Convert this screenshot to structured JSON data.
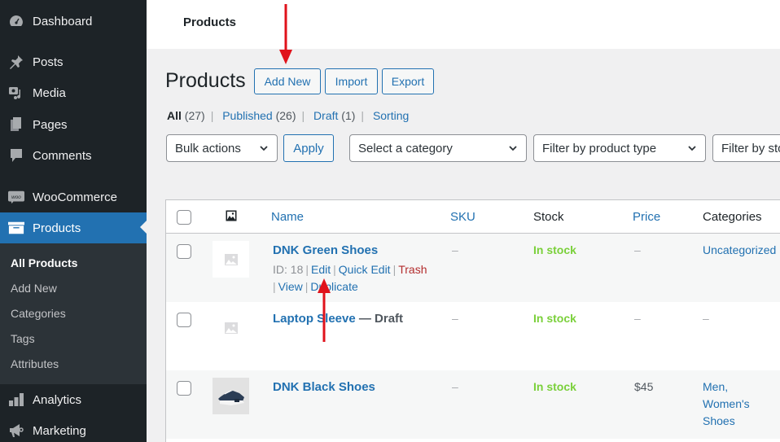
{
  "sidebar": {
    "items": [
      {
        "label": "Dashboard",
        "icon": "dashboard-icon"
      },
      {
        "label": "Posts",
        "icon": "pin-icon"
      },
      {
        "label": "Media",
        "icon": "media-icon"
      },
      {
        "label": "Pages",
        "icon": "pages-icon"
      },
      {
        "label": "Comments",
        "icon": "comment-icon"
      },
      {
        "label": "WooCommerce",
        "icon": "woo-icon"
      },
      {
        "label": "Products",
        "icon": "archive-box-icon",
        "active": true
      },
      {
        "label": "Analytics",
        "icon": "bar-chart-icon"
      },
      {
        "label": "Marketing",
        "icon": "megaphone-icon"
      }
    ],
    "submenu": [
      {
        "label": "All Products",
        "current": true
      },
      {
        "label": "Add New"
      },
      {
        "label": "Categories"
      },
      {
        "label": "Tags"
      },
      {
        "label": "Attributes"
      }
    ]
  },
  "topbar": {
    "title": "Products"
  },
  "heading": {
    "title": "Products",
    "buttons": {
      "add_new": "Add New",
      "import": "Import",
      "export": "Export"
    }
  },
  "views": [
    {
      "label": "All",
      "count": "(27)",
      "current": true
    },
    {
      "label": "Published",
      "count": "(26)"
    },
    {
      "label": "Draft",
      "count": "(1)"
    },
    {
      "label": "Sorting",
      "count": ""
    }
  ],
  "filters": {
    "bulk_actions": "Bulk actions",
    "apply": "Apply",
    "category": "Select a category",
    "product_type": "Filter by product type",
    "stock_status": "Filter by stock status"
  },
  "table": {
    "columns": {
      "image": "image-icon",
      "name": "Name",
      "sku": "SKU",
      "stock": "Stock",
      "price": "Price",
      "categories": "Categories"
    },
    "rows": [
      {
        "name": "DNK Green Shoes",
        "status": "",
        "id_label": "ID: 18",
        "actions": {
          "edit": "Edit",
          "quick_edit": "Quick Edit",
          "trash": "Trash",
          "view": "View",
          "duplicate": "Duplicate"
        },
        "sku": "–",
        "stock": "In stock",
        "price": "–",
        "categories": "Uncategorized",
        "thumbnail": "placeholder"
      },
      {
        "name": "Laptop Sleeve",
        "status": "— Draft",
        "sku": "–",
        "stock": "In stock",
        "price": "–",
        "categories": "–",
        "thumbnail": "placeholder"
      },
      {
        "name": "DNK Black Shoes",
        "status": "",
        "sku": "–",
        "stock": "In stock",
        "price": "$45",
        "categories": "Men, Women's Shoes",
        "thumbnail": "shoe-photo"
      }
    ]
  },
  "colors": {
    "sidebar_bg": "#1d2327",
    "accent": "#2271b1",
    "in_stock": "#7ad03a",
    "trash": "#b32d2e",
    "annotation_arrow": "#e0121b"
  }
}
